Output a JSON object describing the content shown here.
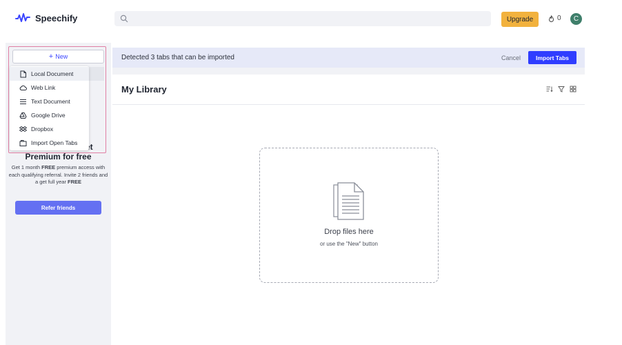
{
  "app": {
    "name": "Speechify"
  },
  "search": {
    "placeholder": ""
  },
  "topbar": {
    "upgrade_label": "Upgrade",
    "credits": "0",
    "avatar_initial": "C"
  },
  "sidebar": {
    "new_label": "New",
    "menu": [
      {
        "label": "Local Document",
        "icon": "document-icon"
      },
      {
        "label": "Web Link",
        "icon": "cloud-icon"
      },
      {
        "label": "Text Document",
        "icon": "text-lines-icon"
      },
      {
        "label": "Google Drive",
        "icon": "google-drive-icon"
      },
      {
        "label": "Dropbox",
        "icon": "dropbox-icon"
      },
      {
        "label": "Import Open Tabs",
        "icon": "tabs-icon"
      }
    ],
    "promo": {
      "title_tail": "et",
      "title": "Premium for free",
      "text_1": "Get 1 month ",
      "text_bold_1": "FREE",
      "text_2": " premium access with each qualifying referral. Invite 2 friends and a get full year ",
      "text_bold_2": "FREE",
      "button_label": "Refer friends"
    }
  },
  "banner": {
    "text": "Detected 3 tabs that can be imported",
    "cancel_label": "Cancel",
    "import_label": "Import Tabs"
  },
  "library": {
    "title": "My Library",
    "tools": [
      "sort-icon",
      "filter-icon",
      "grid-view-icon"
    ]
  },
  "dropzone": {
    "title": "Drop files here",
    "subtitle": "or use the \"New\" button"
  },
  "colors": {
    "accent": "#2f3dff",
    "upgrade": "#f2b23e",
    "avatar": "#3f7f6b",
    "refer": "#6470f2",
    "highlight": "#e07fa3"
  }
}
